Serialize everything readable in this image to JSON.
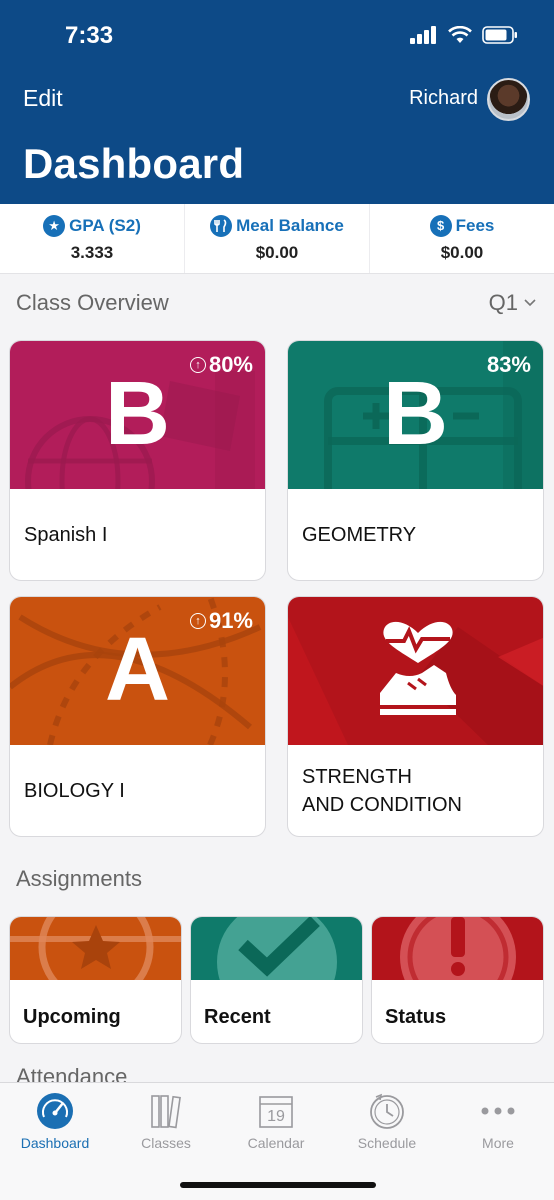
{
  "status_bar": {
    "time": "7:33"
  },
  "header": {
    "edit_label": "Edit",
    "user_name": "Richard",
    "title": "Dashboard"
  },
  "stats": [
    {
      "label": "GPA (S2)",
      "value": "3.333",
      "icon": "star-icon"
    },
    {
      "label": "Meal Balance",
      "value": "$0.00",
      "icon": "utensils-icon"
    },
    {
      "label": "Fees",
      "value": "$0.00",
      "icon": "dollar-icon"
    }
  ],
  "class_overview": {
    "title": "Class Overview",
    "quarter": "Q1",
    "classes": [
      {
        "name": "Spanish I",
        "grade": "B",
        "percent": "80%",
        "trend": "up",
        "color": "#b21d5a"
      },
      {
        "name": "GEOMETRY",
        "grade": "B",
        "percent": "83%",
        "trend": "",
        "color": "#0f7a6a"
      },
      {
        "name": "BIOLOGY I",
        "grade": "A",
        "percent": "91%",
        "trend": "up",
        "color": "#c9520f"
      },
      {
        "name": "STRENGTH\nAND CONDITION",
        "grade": "",
        "percent": "",
        "trend": "",
        "color": "#b3141b",
        "icon": "heart-shoe-icon"
      }
    ]
  },
  "assignments": {
    "title": "Assignments",
    "items": [
      {
        "label": "Upcoming",
        "color": "#c9520f",
        "icon": "star-icon"
      },
      {
        "label": "Recent",
        "color": "#0f7a6a",
        "icon": "check-icon"
      },
      {
        "label": "Status",
        "color": "#b3141b",
        "icon": "exclamation-icon"
      }
    ]
  },
  "attendance": {
    "title": "Attendance"
  },
  "tabs": [
    {
      "label": "Dashboard",
      "icon": "speedometer-icon",
      "active": true
    },
    {
      "label": "Classes",
      "icon": "books-icon",
      "active": false
    },
    {
      "label": "Calendar",
      "icon": "calendar-icon",
      "calendar_day": "19",
      "active": false
    },
    {
      "label": "Schedule",
      "icon": "clock-icon",
      "active": false
    },
    {
      "label": "More",
      "icon": "more-icon",
      "active": false
    }
  ]
}
